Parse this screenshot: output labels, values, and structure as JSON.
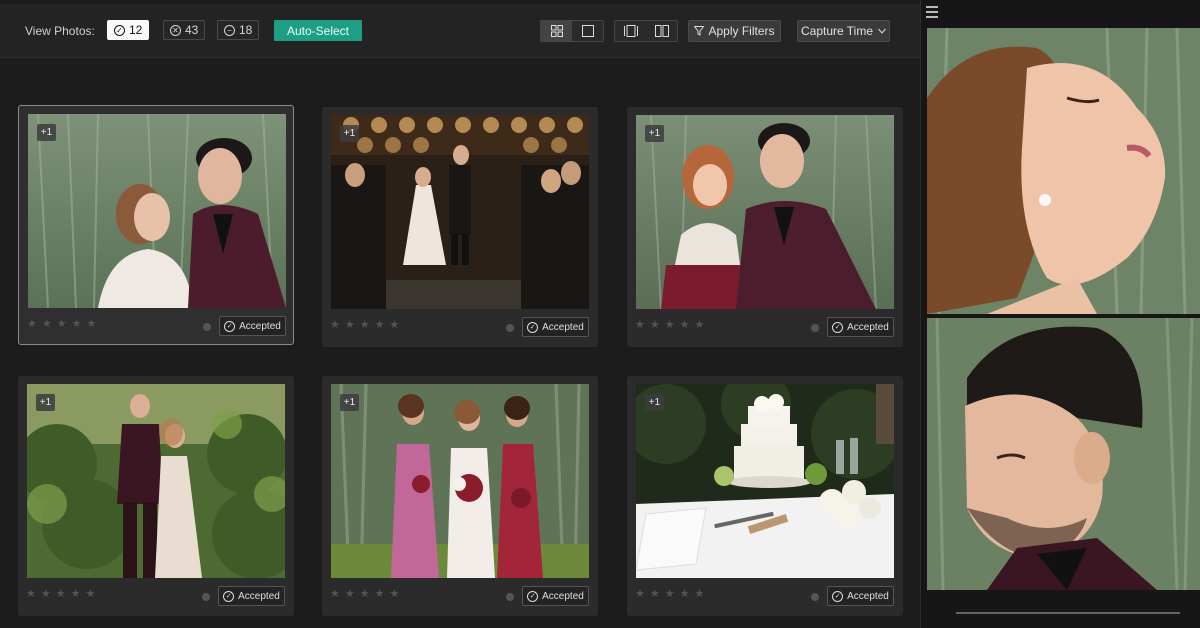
{
  "toolbar": {
    "view_label": "View Photos:",
    "counts": [
      {
        "icon": "check-circle-icon",
        "value": "12",
        "active": true
      },
      {
        "icon": "x-circle-icon",
        "value": "43",
        "active": false
      },
      {
        "icon": "minus-circle-icon",
        "value": "18",
        "active": false
      }
    ],
    "auto_select_label": "Auto-Select",
    "apply_filters_label": "Apply Filters",
    "sort_label": "Capture Time"
  },
  "cards": [
    {
      "badge": "+1",
      "status": "Accepted",
      "rating": 0,
      "scene": "couple-portrait"
    },
    {
      "badge": "+1",
      "status": "Accepted",
      "rating": 0,
      "scene": "aisle-exit"
    },
    {
      "badge": "+1",
      "status": "Accepted",
      "rating": 0,
      "scene": "groom-flower-girl"
    },
    {
      "badge": "+1",
      "status": "Accepted",
      "rating": 0,
      "scene": "couple-vineyard"
    },
    {
      "badge": "+1",
      "status": "Accepted",
      "rating": 0,
      "scene": "bridesmaids"
    },
    {
      "badge": "+1",
      "status": "Accepted",
      "rating": 0,
      "scene": "wedding-cake"
    }
  ],
  "colors": {
    "accent": "#1e9e85",
    "background": "#1c1c1c",
    "card": "#2b2b2b"
  }
}
